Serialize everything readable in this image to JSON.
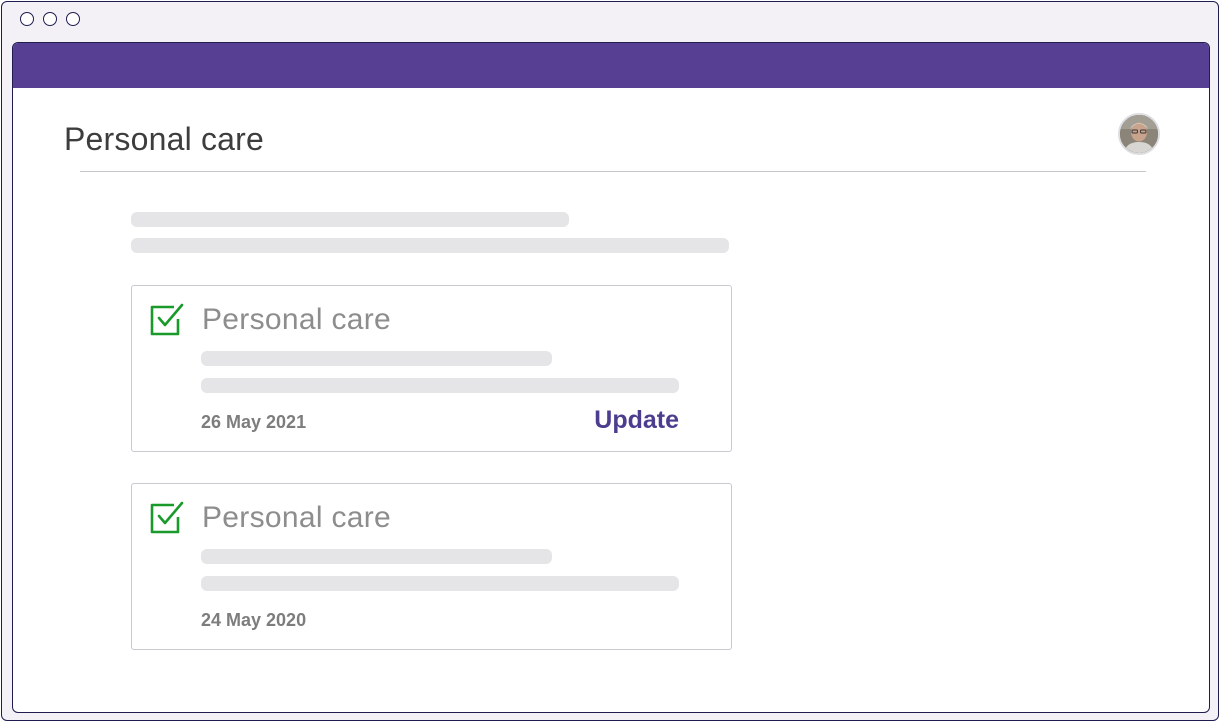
{
  "page": {
    "title": "Personal care"
  },
  "user": {
    "avatar_icon": "user-avatar-photo"
  },
  "colors": {
    "brand": "#574093",
    "check": "#1a9a2b",
    "accent_text": "#4d3d8f"
  },
  "cards": [
    {
      "title": "Personal care",
      "date": "26 May 2021",
      "action_label": "Update",
      "icon": "checkbox-checked-icon"
    },
    {
      "title": "Personal care",
      "date": "24 May 2020",
      "icon": "checkbox-checked-icon"
    }
  ]
}
